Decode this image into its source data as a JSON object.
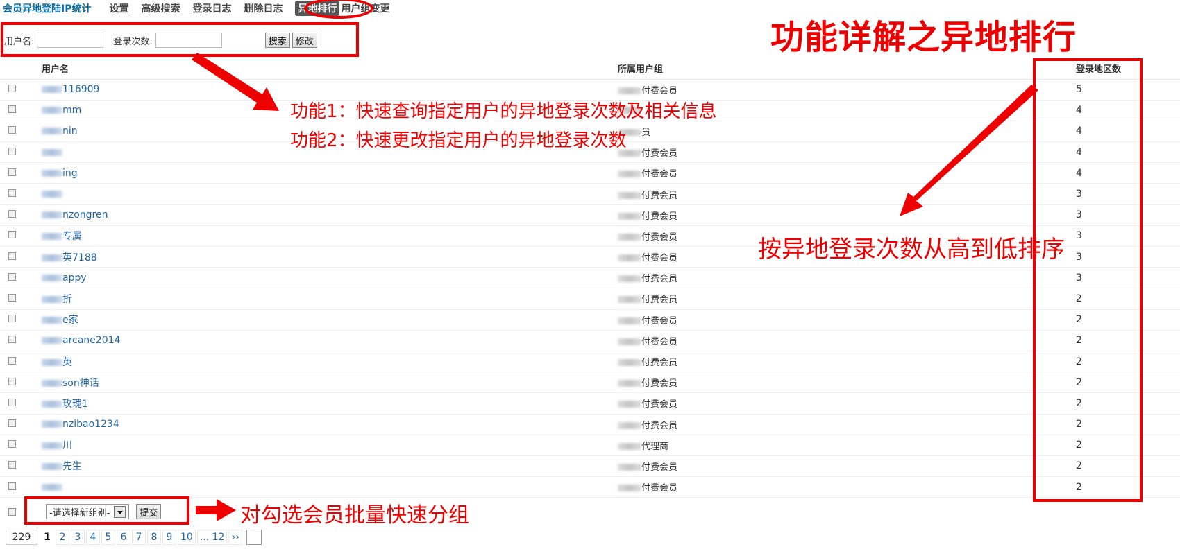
{
  "nav": {
    "brand": "会员异地登陆IP统计",
    "items": [
      "设置",
      "高级搜索",
      "登录日志",
      "删除日志",
      "异地排行",
      "用户组变更"
    ],
    "active_index": 4
  },
  "search": {
    "username_label": "用户名:",
    "count_label": "登录次数:",
    "username_value": "",
    "count_value": "",
    "search_button": "搜索",
    "edit_button": "修改"
  },
  "table": {
    "headers": {
      "user": "用户名",
      "group": "所属用户组",
      "count": "登录地区数"
    },
    "rows": [
      {
        "user": "116909",
        "group": "付费会员",
        "count": "5"
      },
      {
        "user": "mm",
        "group": "",
        "count": "4"
      },
      {
        "user": "nin",
        "group": "员",
        "count": "4"
      },
      {
        "user": "",
        "group": "付费会员",
        "count": "4"
      },
      {
        "user": "ing",
        "group": "付费会员",
        "count": "4"
      },
      {
        "user": "",
        "group": "付费会员",
        "count": "3"
      },
      {
        "user": "nzongren",
        "group": "付费会员",
        "count": "3"
      },
      {
        "user": "专属",
        "group": "付费会员",
        "count": "3"
      },
      {
        "user": "英7188",
        "group": "付费会员",
        "count": "3"
      },
      {
        "user": "appy",
        "group": "付费会员",
        "count": "3"
      },
      {
        "user": "折",
        "group": "付费会员",
        "count": "2"
      },
      {
        "user": "e家",
        "group": "付费会员",
        "count": "2"
      },
      {
        "user": "arcane2014",
        "group": "付费会员",
        "count": "2"
      },
      {
        "user": "英",
        "group": "付费会员",
        "count": "2"
      },
      {
        "user": "son神话",
        "group": "付费会员",
        "count": "2"
      },
      {
        "user": "玫瑰1",
        "group": "付费会员",
        "count": "2"
      },
      {
        "user": "nzibao1234",
        "group": "付费会员",
        "count": "2"
      },
      {
        "user": "川",
        "group": "代理商",
        "count": "2"
      },
      {
        "user": "先生",
        "group": "付费会员",
        "count": "2"
      },
      {
        "user": "",
        "group": "付费会员",
        "count": "2"
      }
    ]
  },
  "batch": {
    "select_value": "-请选择新组别-",
    "submit_button": "提交"
  },
  "pager": {
    "total": "229",
    "current": "1",
    "pages": [
      "2",
      "3",
      "4",
      "5",
      "6",
      "7",
      "8",
      "9",
      "10",
      "... 12",
      "››"
    ]
  },
  "annotations": {
    "title": "功能详解之异地排行",
    "feature1": "功能1：快速查询指定用户的异地登录次数及相关信息",
    "feature2": "功能2：快速更改指定用户的异地登录次数",
    "sort_note": "按异地登录次数从高到低排序",
    "batch_note": "对勾选会员批量快速分组"
  },
  "colors": {
    "annotation": "#e00000",
    "link": "#2366a8",
    "brand": "#0a6ea4"
  }
}
